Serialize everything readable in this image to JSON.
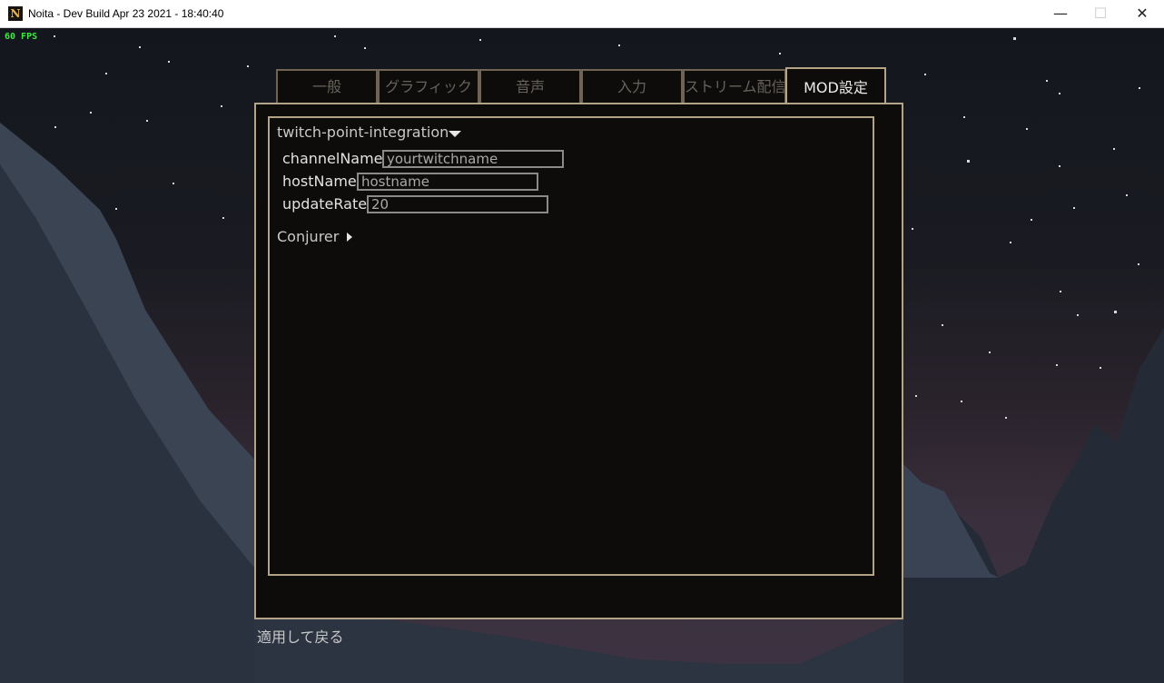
{
  "window": {
    "title": "Noita - Dev Build Apr 23 2021 - 18:40:40",
    "app_icon_glyph": "N",
    "minimize_glyph": "—",
    "maximize_glyph": "☐",
    "close_glyph": "✕"
  },
  "hud": {
    "fps": "60 FPS"
  },
  "tabs": [
    {
      "label": "一般",
      "active": false
    },
    {
      "label": "グラフィック",
      "active": false
    },
    {
      "label": "音声",
      "active": false
    },
    {
      "label": "入力",
      "active": false
    },
    {
      "label": "ストリーム配信",
      "active": false
    },
    {
      "label": "MOD設定",
      "active": true
    }
  ],
  "mods": [
    {
      "name": "twitch-point-integration",
      "expanded": true,
      "icon": "chevron-down-icon",
      "settings": [
        {
          "label": "channelName",
          "value": "yourtwitchname"
        },
        {
          "label": "hostName",
          "value": "hostname"
        },
        {
          "label": "updateRate",
          "value": "20"
        }
      ]
    },
    {
      "name": "Conjurer",
      "expanded": false,
      "icon": "chevron-right-icon"
    }
  ],
  "footer": {
    "apply_back_label": "適用して戻る"
  },
  "colors": {
    "panel_bg": "#0d0c0a",
    "panel_border": "#b3a488",
    "tab_border_inactive": "#6f6453",
    "fps_text": "#3ee83e",
    "input_border": "#8a8a8a"
  }
}
